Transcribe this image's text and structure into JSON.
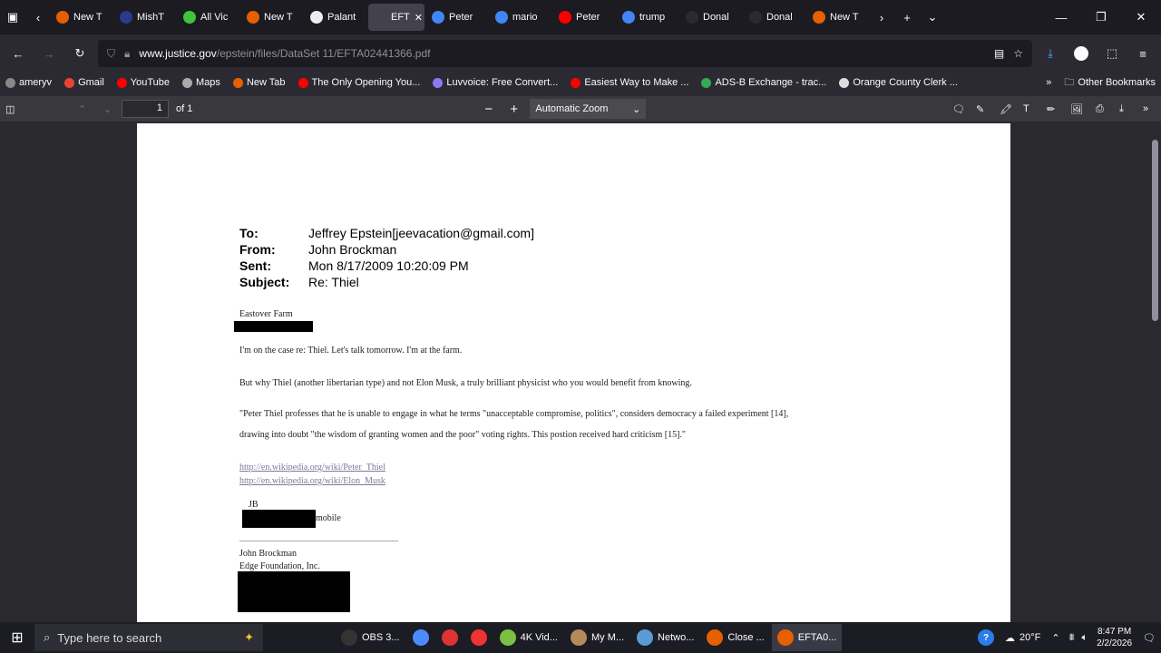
{
  "tabs": [
    {
      "label": "New T",
      "fav": "firefox",
      "color": "#e66000"
    },
    {
      "label": "MishT",
      "fav": "MY",
      "color": "#2b3a8c"
    },
    {
      "label": "All Vic",
      "fav": "play",
      "color": "#3ec43e"
    },
    {
      "label": "New T",
      "fav": "firefox",
      "color": "#e66000"
    },
    {
      "label": "Palant",
      "fav": "W",
      "color": "#eeeeee"
    },
    {
      "label": "EFT",
      "fav": "",
      "color": "#42414d",
      "active": true
    },
    {
      "label": "Peter",
      "fav": "G",
      "color": "#4285f4"
    },
    {
      "label": "mario",
      "fav": "G",
      "color": "#4285f4"
    },
    {
      "label": "Peter",
      "fav": "yt",
      "color": "#ff0000"
    },
    {
      "label": "trump",
      "fav": "G",
      "color": "#4285f4"
    },
    {
      "label": "Donal",
      "fav": "",
      "color": "#2b2a33"
    },
    {
      "label": "Donal",
      "fav": "",
      "color": "#2b2a33"
    },
    {
      "label": "New T",
      "fav": "firefox",
      "color": "#e66000"
    }
  ],
  "url": {
    "host": "www.justice.gov",
    "path": "/epstein/files/DataSet 11/EFTA02441366.pdf"
  },
  "bookmarks": [
    {
      "label": "ameryv",
      "color": "#888"
    },
    {
      "label": "Gmail",
      "color": "#ea4335"
    },
    {
      "label": "YouTube",
      "color": "#ff0000"
    },
    {
      "label": "Maps",
      "color": "#aaa"
    },
    {
      "label": "New Tab",
      "color": "#e66000"
    },
    {
      "label": "The Only Opening You...",
      "color": "#ff0000"
    },
    {
      "label": "Luvvoice: Free Convert...",
      "color": "#8a7cf0"
    },
    {
      "label": "Easiest Way to Make ...",
      "color": "#ff0000"
    },
    {
      "label": "ADS-B Exchange - trac...",
      "color": "#33aa55"
    },
    {
      "label": "Orange County Clerk ...",
      "color": "#dddddd"
    }
  ],
  "other_bookmarks": "Other Bookmarks",
  "pdf": {
    "page_num": "1",
    "of_pages": "of 1",
    "zoom": "Automatic Zoom"
  },
  "email": {
    "to_label": "To:",
    "to": "Jeffrey Epstein[jeevacation@gmail.com]",
    "from_label": "From:",
    "from": "John Brockman",
    "sent_label": "Sent:",
    "sent": "Mon 8/17/2009 10:20:09 PM",
    "subject_label": "Subject:",
    "subject": "Re: Thiel",
    "farm": "Eastover Farm",
    "line1": "I'm on the case re: Thiel. Let's talk tomorrow. I'm at the farm.",
    "line2": "But why Thiel (another libertarian type) and not Elon Musk, a truly brilliant physicist who you would benefit from knowing.",
    "quote1": "\"Peter Thiel professes that he is unable to engage in what he terms \"unacceptable compromise, politics\", considers democracy a failed experiment [14],",
    "quote2": "drawing into doubt \"the wisdom of granting women and the poor\" voting rights. This postion received hard criticism [15].\"",
    "link1": "http://en.wikipedia.org/wiki/Peter_Thiel",
    "link2": "http://en.wikipedia.org/wiki/Elon_Musk",
    "initials": "JB",
    "mobile": "mobile",
    "sig1": "John Brockman",
    "sig2": "Edge Foundation, Inc."
  },
  "taskbar": {
    "search_placeholder": "Type here to search",
    "apps": [
      {
        "label": "OBS 3...",
        "color": "#333"
      },
      {
        "label": "",
        "color": "#4a8cff"
      },
      {
        "label": "",
        "color": "#d33"
      },
      {
        "label": "",
        "color": "#e33"
      },
      {
        "label": "4K Vid...",
        "color": "#7bc043"
      },
      {
        "label": "My M...",
        "color": "#b58a5a"
      },
      {
        "label": "Netwo...",
        "color": "#5a9bd5"
      },
      {
        "label": "Close ...",
        "color": "#e66000"
      },
      {
        "label": "EFTA0...",
        "color": "#e66000",
        "active": true
      }
    ],
    "weather": "20°F",
    "time": "8:47 PM",
    "date": "2/2/2026"
  }
}
